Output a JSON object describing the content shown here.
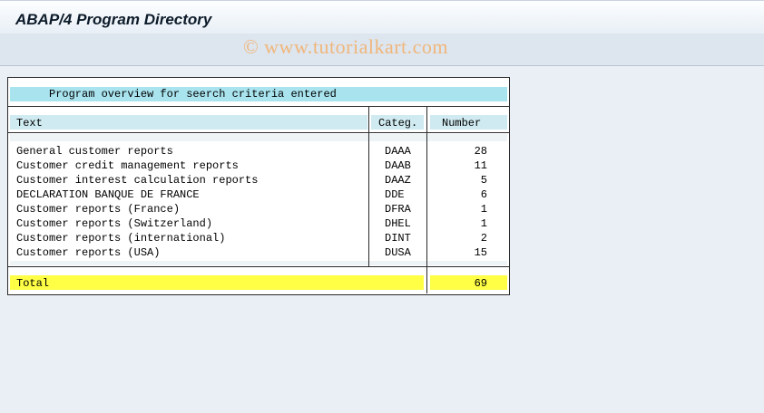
{
  "window": {
    "title": "ABAP/4 Program Directory"
  },
  "watermark": "© www.tutorialkart.com",
  "report": {
    "heading": "Program overview for seerch criteria entered",
    "columns": {
      "text": "Text",
      "categ": "Categ.",
      "number": "Number"
    },
    "rows": [
      {
        "text": "General customer reports",
        "categ": "DAAA",
        "number": "28"
      },
      {
        "text": "Customer credit management reports",
        "categ": "DAAB",
        "number": "11"
      },
      {
        "text": "Customer interest calculation reports",
        "categ": "DAAZ",
        "number": "5"
      },
      {
        "text": "DECLARATION BANQUE DE FRANCE",
        "categ": "DDE",
        "number": "6"
      },
      {
        "text": "Customer reports (France)",
        "categ": "DFRA",
        "number": "1"
      },
      {
        "text": "Customer reports (Switzerland)",
        "categ": "DHEL",
        "number": "1"
      },
      {
        "text": "Customer reports (international)",
        "categ": "DINT",
        "number": "2"
      },
      {
        "text": "Customer reports (USA)",
        "categ": "DUSA",
        "number": "15"
      }
    ],
    "total": {
      "label": "Total",
      "value": "69"
    }
  }
}
